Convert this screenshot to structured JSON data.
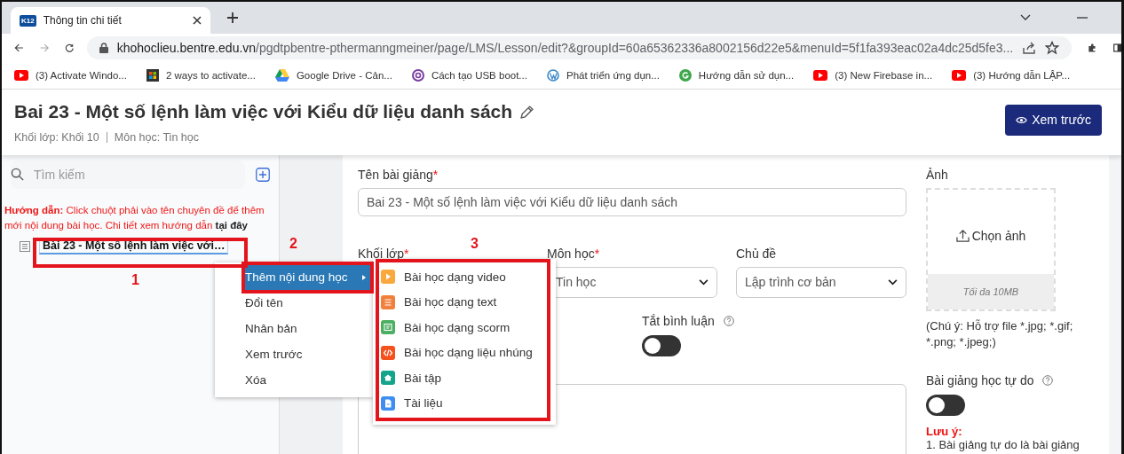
{
  "browser": {
    "tab_title": "Thông tin chi tiết",
    "favicon": "K12",
    "url_host": "khohoclieu.bentre.edu.vn",
    "url_path": "/pgdtpbentre-pthermanngmeiner/page/LMS/Lesson/edit?&groupId=60a65362336a8002156d22e5&menuId=5f1fa393eac02a4dc25d5fe3...",
    "bookmarks": [
      {
        "label": "(3) Activate Windo...",
        "kind": "youtube"
      },
      {
        "label": "2 ways to activate...",
        "kind": "windows"
      },
      {
        "label": "Google Drive - Cản...",
        "kind": "drive"
      },
      {
        "label": "Cách tạo USB boot...",
        "kind": "ring"
      },
      {
        "label": "Phát triển ứng dụn...",
        "kind": "wordpress"
      },
      {
        "label": "Hướng dẫn sử dụn...",
        "kind": "g"
      },
      {
        "label": "(3) New Firebase in...",
        "kind": "youtube"
      },
      {
        "label": "(3) Hướng dẫn LẬP...",
        "kind": "youtube"
      }
    ]
  },
  "page": {
    "title": "Bai 23 - Một số lệnh làm việc với Kiểu dữ liệu danh sách",
    "meta": [
      "Khối lớp: Khối 10",
      "Môn học: Tin học"
    ],
    "preview_button": "Xem trước"
  },
  "sidebar": {
    "search_placeholder": "Tìm kiếm",
    "guide_label": "Hướng dẫn:",
    "guide_text": "Click chuột phải vào tên chuyên đề để thêm mới nội dung bài học. Chi tiết xem hướng dẫn",
    "guide_link": "tại đây",
    "tree": [
      {
        "label": "Bài 23 - Một số lệnh làm việc với…"
      }
    ]
  },
  "context_menu": [
    {
      "label": "Thêm nội dung học",
      "selected": true,
      "submenu": true
    },
    {
      "label": "Đổi tên",
      "selected": false,
      "submenu": false
    },
    {
      "label": "Nhân bản",
      "selected": false,
      "submenu": false
    },
    {
      "label": "Xem trước",
      "selected": false,
      "submenu": false
    },
    {
      "label": "Xóa",
      "selected": false,
      "submenu": false
    }
  ],
  "submenu": [
    {
      "label": "Bài học dạng video",
      "kind": "video",
      "color": "#f9a93b"
    },
    {
      "label": "Bài học dạng text",
      "kind": "text",
      "color": "#f0803c"
    },
    {
      "label": "Bài học dạng scorm",
      "kind": "scorm",
      "color": "#4caf62"
    },
    {
      "label": "Bài học dạng liệu nhúng",
      "kind": "embed",
      "color": "#f4511e"
    },
    {
      "label": "Bài tập",
      "kind": "exercise",
      "color": "#14a38b"
    },
    {
      "label": "Tài liệu",
      "kind": "document",
      "color": "#3d8ef0"
    }
  ],
  "form": {
    "required_mark": "*",
    "name_label": "Tên bài giảng",
    "name_required": true,
    "name_value": "Bai 23 -  Một số lệnh làm việc với Kiểu dữ liệu danh sách",
    "selects": [
      {
        "label": "Khối lớp",
        "required": true
      },
      {
        "label": "Môn học",
        "required": true,
        "value": "Tin học"
      },
      {
        "label": "Chủ đề",
        "required": false,
        "value": "Lập trình cơ bản"
      }
    ],
    "comment_label": "Tắt bình luận",
    "comment_on": false,
    "image_label": "Ảnh",
    "upload": "Chọn ảnh",
    "limit": "Tối đa 10MB",
    "image_note": "(Chú ý: Hỗ trợ file *.jpg; *.gif; *.png; *.jpeg;)",
    "free_label": "Bài giảng học tự do",
    "free_on": false,
    "notice_title": "Lưu ý:",
    "notice_text": "1. Bài giảng tự do là bài giảng"
  },
  "annotations": [
    "1",
    "2",
    "3"
  ]
}
